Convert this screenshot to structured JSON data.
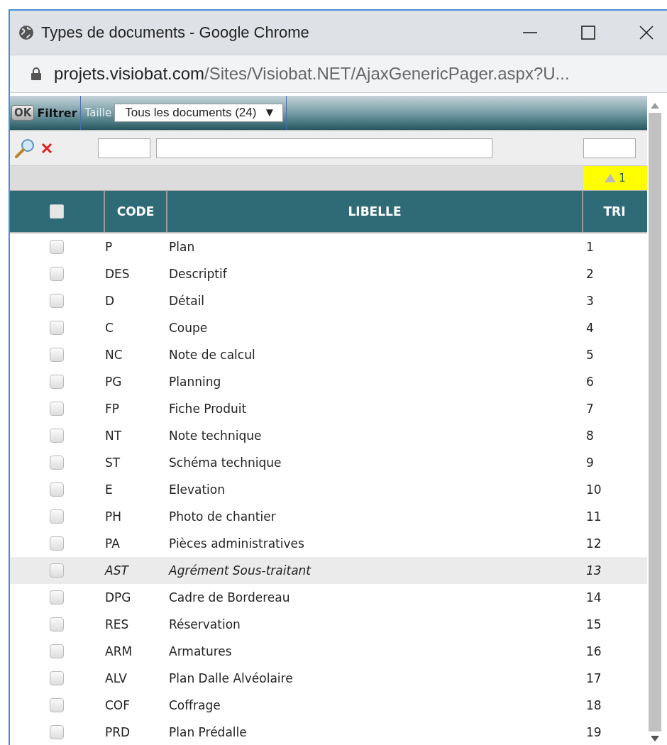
{
  "window": {
    "title": "Types de documents - Google Chrome"
  },
  "address_bar": {
    "domain": "projets.visiobat.com",
    "path": "/Sites/Visiobat.NET/AjaxGenericPager.aspx?U..."
  },
  "toolbar": {
    "ok_button": "OK",
    "filter_label": "Filtrer",
    "size_label": "Taille",
    "size_select": "Tous les documents (24)",
    "select_arrow": "▼"
  },
  "sort_badge": {
    "text": "1"
  },
  "table": {
    "header_checked": false,
    "columns": [
      "CODE",
      "LIBELLE",
      "TRI"
    ],
    "rows": [
      {
        "code": "P",
        "libelle": "Plan",
        "tri": "1",
        "checked": false,
        "highlighted": false
      },
      {
        "code": "DES",
        "libelle": "Descriptif",
        "tri": "2",
        "checked": false,
        "highlighted": false
      },
      {
        "code": "D",
        "libelle": "Détail",
        "tri": "3",
        "checked": false,
        "highlighted": false
      },
      {
        "code": "C",
        "libelle": "Coupe",
        "tri": "4",
        "checked": false,
        "highlighted": false
      },
      {
        "code": "NC",
        "libelle": "Note de calcul",
        "tri": "5",
        "checked": false,
        "highlighted": false
      },
      {
        "code": "PG",
        "libelle": "Planning",
        "tri": "6",
        "checked": false,
        "highlighted": false
      },
      {
        "code": "FP",
        "libelle": "Fiche Produit",
        "tri": "7",
        "checked": false,
        "highlighted": false
      },
      {
        "code": "NT",
        "libelle": "Note technique",
        "tri": "8",
        "checked": false,
        "highlighted": false
      },
      {
        "code": "ST",
        "libelle": "Schéma technique",
        "tri": "9",
        "checked": false,
        "highlighted": false
      },
      {
        "code": "E",
        "libelle": "Elevation",
        "tri": "10",
        "checked": false,
        "highlighted": false
      },
      {
        "code": "PH",
        "libelle": "Photo de chantier",
        "tri": "11",
        "checked": false,
        "highlighted": false
      },
      {
        "code": "PA",
        "libelle": "Pièces administratives",
        "tri": "12",
        "checked": false,
        "highlighted": false
      },
      {
        "code": "AST",
        "libelle": "Agrément Sous-traitant",
        "tri": "13",
        "checked": false,
        "highlighted": true
      },
      {
        "code": "DPG",
        "libelle": "Cadre de Bordereau",
        "tri": "14",
        "checked": false,
        "highlighted": false
      },
      {
        "code": "RES",
        "libelle": "Réservation",
        "tri": "15",
        "checked": false,
        "highlighted": false
      },
      {
        "code": "ARM",
        "libelle": "Armatures",
        "tri": "16",
        "checked": false,
        "highlighted": false
      },
      {
        "code": "ALV",
        "libelle": "Plan Dalle Alvéolaire",
        "tri": "17",
        "checked": false,
        "highlighted": false
      },
      {
        "code": "COF",
        "libelle": "Coffrage",
        "tri": "18",
        "checked": false,
        "highlighted": false
      },
      {
        "code": "PRD",
        "libelle": "Plan Prédalle",
        "tri": "19",
        "checked": false,
        "highlighted": false
      }
    ]
  }
}
